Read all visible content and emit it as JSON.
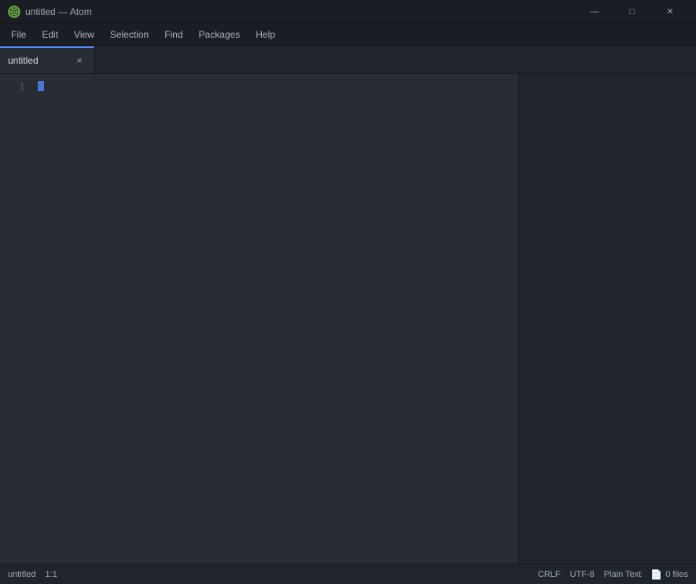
{
  "titlebar": {
    "title": "untitled — Atom",
    "app_name": "Atom"
  },
  "menubar": {
    "items": [
      "File",
      "Edit",
      "View",
      "Selection",
      "Find",
      "Packages",
      "Help"
    ]
  },
  "tabs": [
    {
      "label": "untitled",
      "active": true,
      "close_label": "×"
    }
  ],
  "editor": {
    "line_numbers": [
      "1"
    ],
    "content": ""
  },
  "statusbar": {
    "filename": "untitled",
    "cursor_pos": "1:1",
    "line_endings": "CRLF",
    "encoding": "UTF-8",
    "grammar": "Plain Text",
    "files_label": "0 files"
  }
}
